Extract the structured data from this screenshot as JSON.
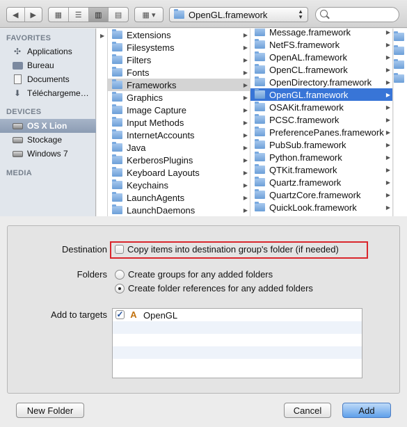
{
  "toolbar": {
    "back_icon": "chevron-left-icon",
    "forward_icon": "chevron-right-icon",
    "view_modes": [
      "icon-view-icon",
      "list-view-icon",
      "column-view-icon",
      "coverflow-view-icon"
    ],
    "active_view": "column-view-icon",
    "arrange_icon": "arrange-grid-icon",
    "path_label": "OpenGL.framework",
    "search_placeholder": ""
  },
  "sidebar": {
    "favorites_heading": "FAVORITES",
    "favorites": [
      {
        "label": "Applications",
        "icon": "applications-icon"
      },
      {
        "label": "Bureau",
        "icon": "desktop-icon"
      },
      {
        "label": "Documents",
        "icon": "documents-icon"
      },
      {
        "label": "Téléchargeme…",
        "icon": "downloads-icon"
      }
    ],
    "devices_heading": "DEVICES",
    "devices": [
      {
        "label": "OS X Lion",
        "icon": "disk-icon",
        "selected": true
      },
      {
        "label": "Stockage",
        "icon": "disk-icon"
      },
      {
        "label": "Windows 7",
        "icon": "disk-icon"
      }
    ],
    "media_heading": "MEDIA"
  },
  "columns": {
    "col1_items": [
      "Extensions",
      "Filesystems",
      "Filters",
      "Fonts",
      "Frameworks",
      "Graphics",
      "Image Capture",
      "Input Methods",
      "InternetAccounts",
      "Java",
      "KerberosPlugins",
      "Keyboard Layouts",
      "Keychains",
      "LaunchAgents",
      "LaunchDaemons"
    ],
    "col1_selected": "Frameworks",
    "col2_items": [
      "Message.framework",
      "NetFS.framework",
      "OpenAL.framework",
      "OpenCL.framework",
      "OpenDirectory.framework",
      "OpenGL.framework",
      "OSAKit.framework",
      "PCSC.framework",
      "PreferencePanes.framework",
      "PubSub.framework",
      "Python.framework",
      "QTKit.framework",
      "Quartz.framework",
      "QuartzCore.framework",
      "QuickLook.framework"
    ],
    "col2_selected": "OpenGL.framework"
  },
  "options": {
    "destination_label": "Destination",
    "copy_items_label": "Copy items into destination group's folder (if needed)",
    "copy_items_checked": false,
    "folders_label": "Folders",
    "create_groups_label": "Create groups for any added folders",
    "create_refs_label": "Create folder references for any added folders",
    "selected_folder_option": "create_refs",
    "targets_label": "Add to targets",
    "targets": [
      {
        "label": "OpenGL",
        "checked": true,
        "icon": "app-target-icon"
      }
    ]
  },
  "buttons": {
    "new_folder": "New Folder",
    "cancel": "Cancel",
    "add": "Add"
  },
  "colors": {
    "selection_blue": "#3875d7",
    "highlight_red": "#d9262c",
    "sidebar_bg": "#e1e6ec"
  }
}
